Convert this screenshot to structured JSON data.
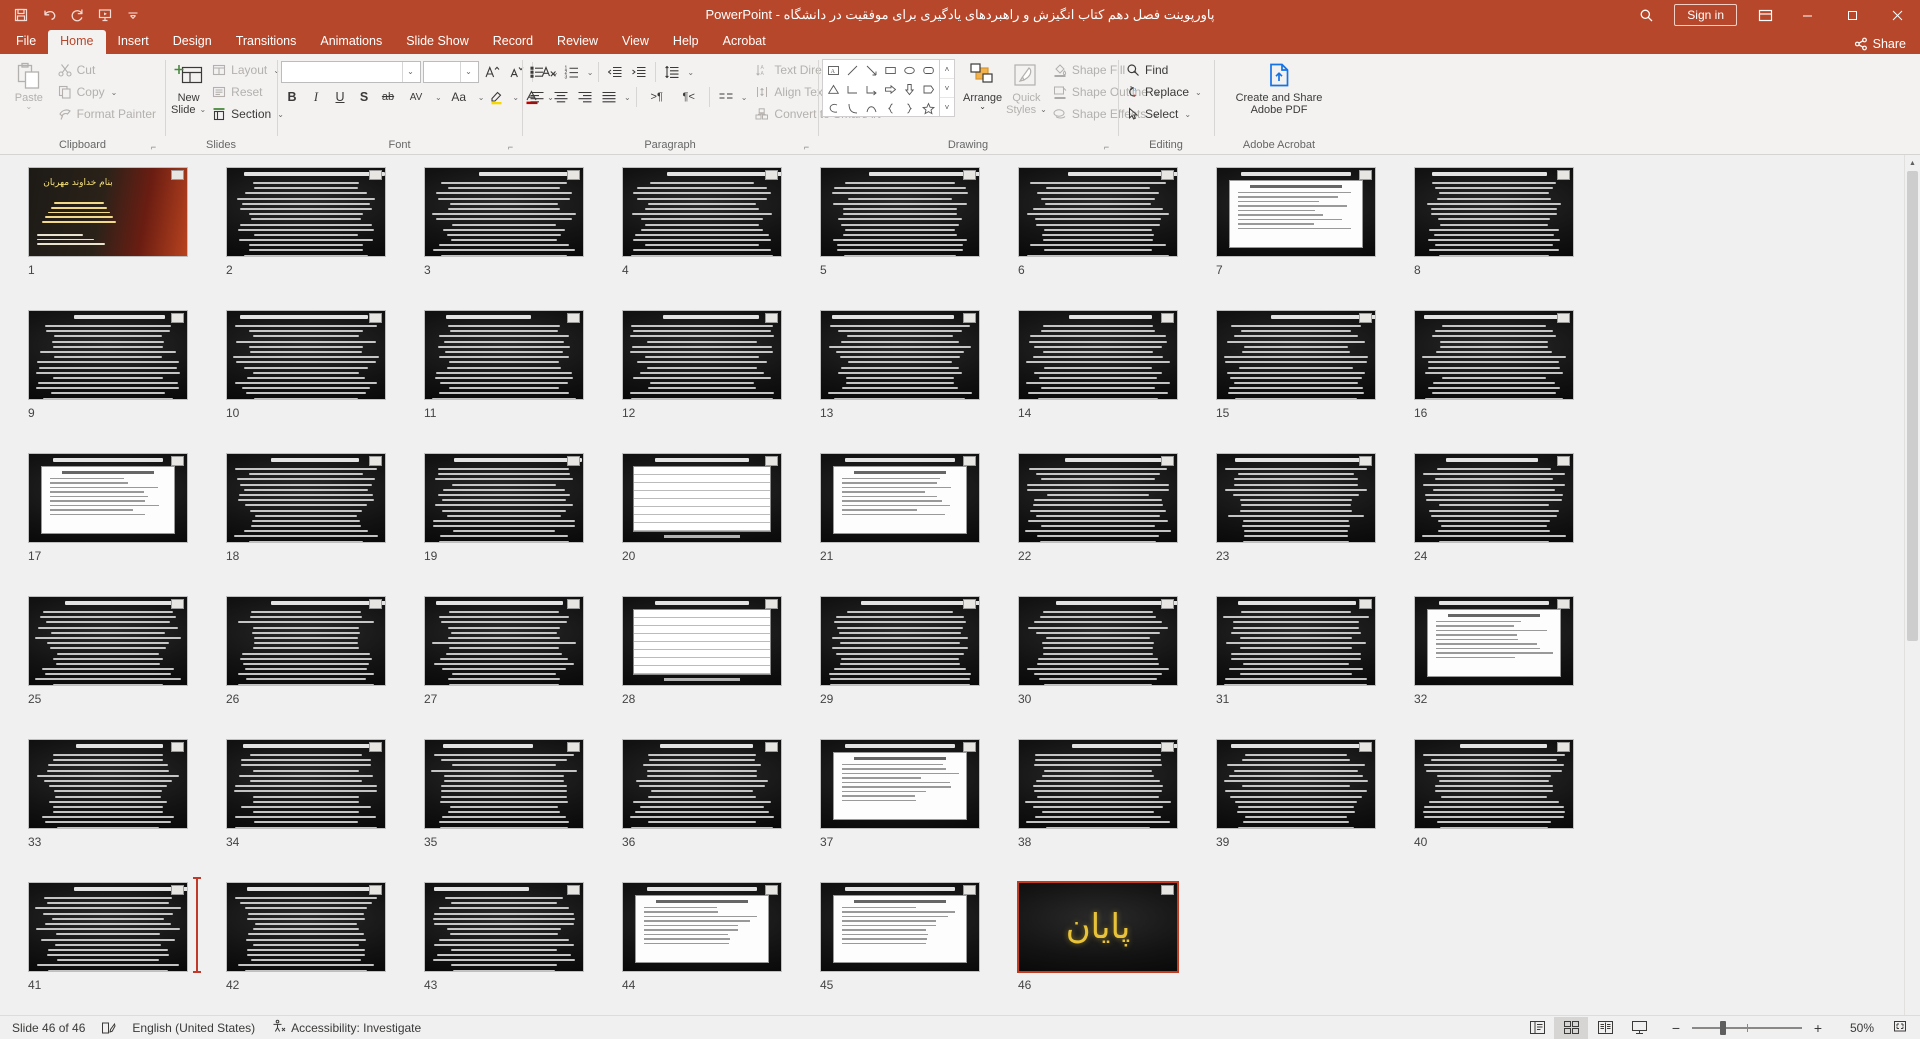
{
  "window": {
    "title_persian": "پاورپوینت فصل دهم کتاب انگیزش و راهبردهای یادگیری برای موفقیت در دانشگاه",
    "separator": "-",
    "app_name": "PowerPoint",
    "sign_in": "Sign in",
    "share": "Share",
    "accent_color": "#B7472A",
    "quick_access": [
      {
        "name": "save-icon",
        "tooltip": "Save"
      },
      {
        "name": "undo-icon",
        "tooltip": "Undo"
      },
      {
        "name": "redo-icon",
        "tooltip": "Redo"
      },
      {
        "name": "start-presentation-icon",
        "tooltip": "Start From Beginning"
      },
      {
        "name": "customize-qat-icon",
        "tooltip": "Customize Quick Access Toolbar"
      }
    ],
    "window_controls": [
      "minimize",
      "maximize",
      "close"
    ],
    "search_icon": "search-icon",
    "ribbon_display_icon": "ribbon-display-options-icon"
  },
  "tabs": [
    {
      "label": "File",
      "active": false
    },
    {
      "label": "Home",
      "active": true
    },
    {
      "label": "Insert",
      "active": false
    },
    {
      "label": "Design",
      "active": false
    },
    {
      "label": "Transitions",
      "active": false
    },
    {
      "label": "Animations",
      "active": false
    },
    {
      "label": "Slide Show",
      "active": false
    },
    {
      "label": "Record",
      "active": false
    },
    {
      "label": "Review",
      "active": false
    },
    {
      "label": "View",
      "active": false
    },
    {
      "label": "Help",
      "active": false
    },
    {
      "label": "Acrobat",
      "active": false
    }
  ],
  "ribbon": {
    "clipboard": {
      "label": "Clipboard",
      "paste": "Paste",
      "cut": "Cut",
      "copy": "Copy",
      "format_painter": "Format Painter"
    },
    "slides": {
      "label": "Slides",
      "new_slide": "New\nSlide",
      "new_slide_l1": "New",
      "new_slide_l2": "Slide",
      "layout": "Layout",
      "reset": "Reset",
      "section": "Section"
    },
    "font": {
      "label": "Font",
      "font_name_value": "",
      "font_size_value": "",
      "increase_font": "A",
      "decrease_font": "A",
      "clear_formatting": "clear-formatting-icon",
      "bold": "B",
      "italic": "I",
      "underline": "U",
      "shadow": "S",
      "strikethrough": "ab",
      "character_spacing": "AV",
      "change_case": "Aa",
      "text_highlight": "text-highlight-icon",
      "font_color": "A"
    },
    "paragraph": {
      "label": "Paragraph",
      "bullets": "bullets-icon",
      "numbering": "numbering-icon",
      "decrease_indent": "decrease-indent-icon",
      "increase_indent": "increase-indent-icon",
      "line_spacing": "line-spacing-icon",
      "align_left": "align-left-icon",
      "align_center": "align-center-icon",
      "align_right": "align-right-icon",
      "justify": "justify-icon",
      "ltr": ">¶",
      "rtl": "¶<",
      "columns": "columns-icon",
      "text_direction": "Text Direction",
      "align_text": "Align Text",
      "convert_to_smartart": "Convert to SmartArt"
    },
    "drawing": {
      "label": "Drawing",
      "arrange": "Arrange",
      "quick_styles_l1": "Quick",
      "quick_styles_l2": "Styles",
      "shape_fill": "Shape Fill",
      "shape_outline": "Shape Outline",
      "shape_effects": "Shape Effects"
    },
    "editing": {
      "label": "Editing",
      "find": "Find",
      "replace": "Replace",
      "select": "Select"
    },
    "acrobat": {
      "label": "Adobe Acrobat",
      "create_and_share_l1": "Create and Share",
      "create_and_share_l2": "Adobe PDF"
    }
  },
  "slides": [
    {
      "num": "1",
      "kind": "title",
      "selected": false
    },
    {
      "num": "2",
      "kind": "text",
      "selected": false
    },
    {
      "num": "3",
      "kind": "text",
      "selected": false
    },
    {
      "num": "4",
      "kind": "text",
      "selected": false
    },
    {
      "num": "5",
      "kind": "text",
      "selected": false
    },
    {
      "num": "6",
      "kind": "text",
      "selected": false
    },
    {
      "num": "7",
      "kind": "white",
      "selected": false
    },
    {
      "num": "8",
      "kind": "text",
      "selected": false
    },
    {
      "num": "9",
      "kind": "text",
      "selected": false
    },
    {
      "num": "10",
      "kind": "text",
      "selected": false
    },
    {
      "num": "11",
      "kind": "text",
      "selected": false
    },
    {
      "num": "12",
      "kind": "text",
      "selected": false
    },
    {
      "num": "13",
      "kind": "text",
      "selected": false
    },
    {
      "num": "14",
      "kind": "text",
      "selected": false
    },
    {
      "num": "15",
      "kind": "text",
      "selected": false
    },
    {
      "num": "16",
      "kind": "text",
      "selected": false
    },
    {
      "num": "17",
      "kind": "white",
      "selected": false
    },
    {
      "num": "18",
      "kind": "text",
      "selected": false
    },
    {
      "num": "19",
      "kind": "text",
      "selected": false
    },
    {
      "num": "20",
      "kind": "table",
      "selected": false
    },
    {
      "num": "21",
      "kind": "white",
      "selected": false
    },
    {
      "num": "22",
      "kind": "text",
      "selected": false
    },
    {
      "num": "23",
      "kind": "text",
      "selected": false
    },
    {
      "num": "24",
      "kind": "text",
      "selected": false
    },
    {
      "num": "25",
      "kind": "text",
      "selected": false
    },
    {
      "num": "26",
      "kind": "text",
      "selected": false
    },
    {
      "num": "27",
      "kind": "text",
      "selected": false
    },
    {
      "num": "28",
      "kind": "table",
      "selected": false
    },
    {
      "num": "29",
      "kind": "text",
      "selected": false
    },
    {
      "num": "30",
      "kind": "text",
      "selected": false
    },
    {
      "num": "31",
      "kind": "text",
      "selected": false
    },
    {
      "num": "32",
      "kind": "white",
      "selected": false
    },
    {
      "num": "33",
      "kind": "text",
      "selected": false
    },
    {
      "num": "34",
      "kind": "text",
      "selected": false
    },
    {
      "num": "35",
      "kind": "text",
      "selected": false
    },
    {
      "num": "36",
      "kind": "text",
      "selected": false
    },
    {
      "num": "37",
      "kind": "white",
      "selected": false
    },
    {
      "num": "38",
      "kind": "text",
      "selected": false
    },
    {
      "num": "39",
      "kind": "text",
      "selected": false
    },
    {
      "num": "40",
      "kind": "text",
      "selected": false
    },
    {
      "num": "41",
      "kind": "text",
      "selected": false
    },
    {
      "num": "42",
      "kind": "text",
      "selected": false
    },
    {
      "num": "43",
      "kind": "text",
      "selected": false
    },
    {
      "num": "44",
      "kind": "white",
      "selected": false
    },
    {
      "num": "45",
      "kind": "white",
      "selected": false
    },
    {
      "num": "46",
      "kind": "payan",
      "selected": true,
      "text": "پایان"
    }
  ],
  "statusbar": {
    "slide_counter": "Slide 46 of 46",
    "notes_icon": "notes-icon",
    "language": "English (United States)",
    "accessibility_icon": "accessibility-icon",
    "accessibility": "Accessibility: Investigate",
    "views": [
      {
        "name": "normal-view-button",
        "active": false
      },
      {
        "name": "slide-sorter-view-button",
        "active": true
      },
      {
        "name": "reading-view-button",
        "active": false
      },
      {
        "name": "slide-show-button",
        "active": false
      }
    ],
    "zoom_out": "−",
    "zoom_in": "+",
    "zoom_level": "50%",
    "fit_to_window_icon": "fit-slide-to-window-icon"
  }
}
